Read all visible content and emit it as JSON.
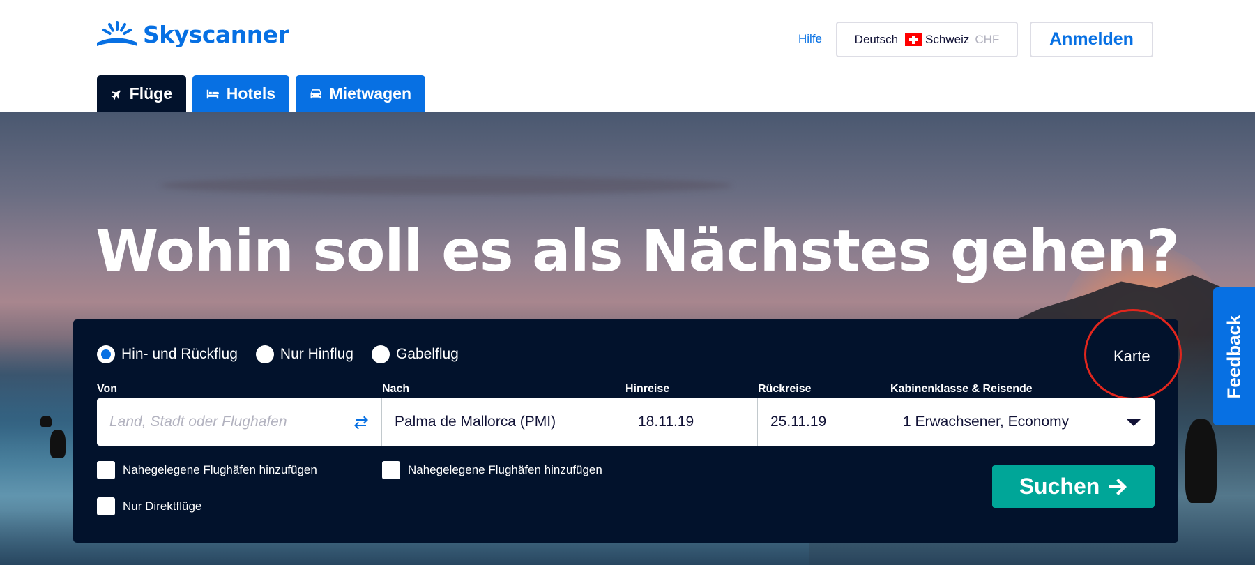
{
  "header": {
    "logo_text": "Skyscanner",
    "help_link": "Hilfe",
    "locale": {
      "language": "Deutsch",
      "country": "Schweiz",
      "currency": "CHF"
    },
    "signin_label": "Anmelden"
  },
  "tabs": [
    {
      "label": "Flüge",
      "icon": "plane-icon",
      "active": true
    },
    {
      "label": "Hotels",
      "icon": "bed-icon",
      "active": false
    },
    {
      "label": "Mietwagen",
      "icon": "car-icon",
      "active": false
    }
  ],
  "hero": {
    "headline": "Wohin soll es als Nächstes gehen?"
  },
  "search": {
    "trip_types": [
      {
        "label": "Hin- und Rückflug",
        "selected": true
      },
      {
        "label": "Nur Hinflug",
        "selected": false
      },
      {
        "label": "Gabelflug",
        "selected": false
      }
    ],
    "map_link": "Karte",
    "fields": {
      "from": {
        "label": "Von",
        "value": "",
        "placeholder": "Land, Stadt oder Flughafen"
      },
      "to": {
        "label": "Nach",
        "value": "Palma de Mallorca (PMI)"
      },
      "depart": {
        "label": "Hinreise",
        "value": "18.11.19"
      },
      "return": {
        "label": "Rückreise",
        "value": "25.11.19"
      },
      "cabin": {
        "label": "Kabinenklasse & Reisende",
        "value": "1 Erwachsener, Economy"
      }
    },
    "checkboxes": {
      "nearby_from": "Nahegelegene Flughäfen hinzufügen",
      "nearby_to": "Nahegelegene Flughäfen hinzufügen",
      "direct_only": "Nur Direktflüge"
    },
    "search_button": "Suchen"
  },
  "feedback_label": "Feedback",
  "colors": {
    "brand_blue": "#0770e3",
    "navy": "#02122c",
    "search_green": "#00a698",
    "annotation_red": "#e1261d"
  }
}
